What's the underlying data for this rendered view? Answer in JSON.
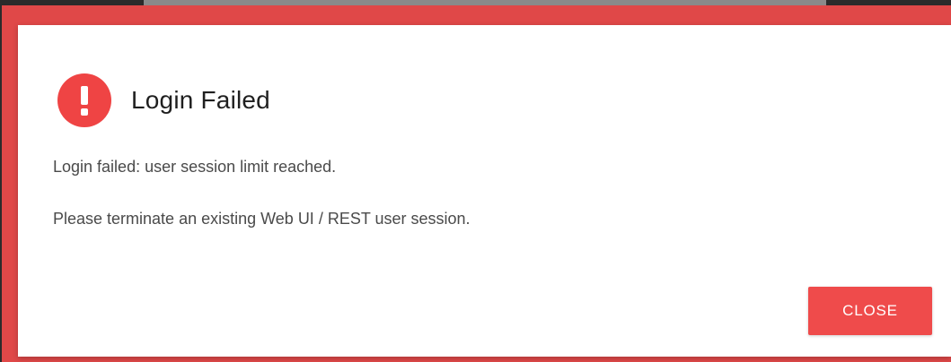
{
  "dialog": {
    "title": "Login Failed",
    "icon": "error-exclamation-icon",
    "messages": [
      "Login failed: user session limit reached.",
      "Please terminate an existing Web UI / REST user session."
    ],
    "close_label": "CLOSE"
  },
  "colors": {
    "accent": "#ef4b4b",
    "frame": "#e04848",
    "icon_bg": "#ef4444",
    "text_primary": "#1f1f1f",
    "text_secondary": "#4a4a4a"
  }
}
